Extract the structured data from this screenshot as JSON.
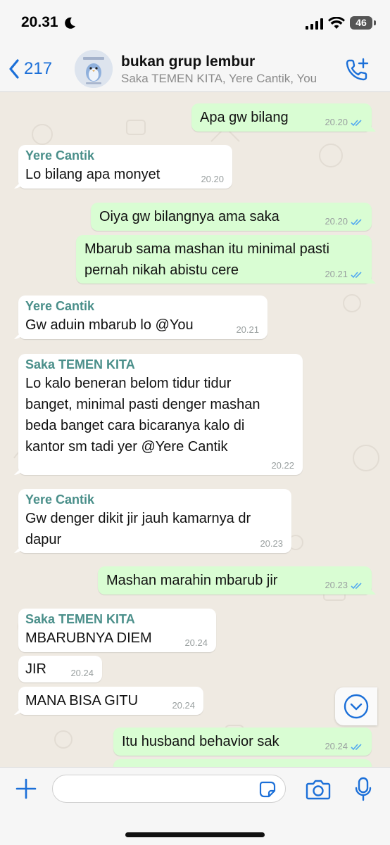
{
  "status_bar": {
    "time": "20.31",
    "battery": "46"
  },
  "header": {
    "back_count": "217",
    "group_name": "bukan grup lembur",
    "members": "Saka TEMEN KITA, Yere Cantik, You"
  },
  "messages": [
    {
      "dir": "out",
      "text": "Apa gw bilang",
      "time": "20.20"
    },
    {
      "dir": "in",
      "sender": "Yere Cantik",
      "text": "Lo bilang apa monyet",
      "time": "20.20"
    },
    {
      "dir": "out",
      "text": "Oiya gw bilangnya ama saka",
      "time": "20.20"
    },
    {
      "dir": "out",
      "text": "Mbarub sama mashan itu minimal pasti\npernah nikah abistu cere",
      "time": "20.21"
    },
    {
      "dir": "in",
      "sender": "Yere Cantik",
      "text": "Gw aduin mbarub lo @You",
      "time": "20.21"
    },
    {
      "dir": "in",
      "sender": "Saka TEMEN KITA",
      "text": "Lo kalo beneran belom tidur tidur\nbanget, minimal pasti denger mashan\nbeda banget cara bicaranya kalo di\nkantor sm tadi yer @Yere Cantik",
      "time": "20.22"
    },
    {
      "dir": "in",
      "sender": "Yere Cantik",
      "text": "Gw denger dikit jir jauh kamarnya dr\ndapur",
      "time": "20.23"
    },
    {
      "dir": "out",
      "text": "Mashan marahin mbarub jir",
      "time": "20.23"
    },
    {
      "dir": "in",
      "sender": "Saka TEMEN KITA",
      "text": "MBARUBNYA DIEM",
      "time": "20.24"
    },
    {
      "dir": "in",
      "text": "JIR",
      "time": "20.24"
    },
    {
      "dir": "in",
      "text": "MANA BISA GITU",
      "time": "20.24"
    },
    {
      "dir": "out",
      "text": "Itu husband behavior sak",
      "time": "20.24"
    },
    {
      "dir": "out",
      "text": "",
      "time": ""
    }
  ],
  "input": {
    "placeholder": ""
  },
  "colors": {
    "outgoing_bubble": "#d9fdd3",
    "incoming_bubble": "#ffffff",
    "accent": "#1b6fd8",
    "sender_name": "#4a8f8a",
    "read_ticks": "#53a8f0"
  }
}
